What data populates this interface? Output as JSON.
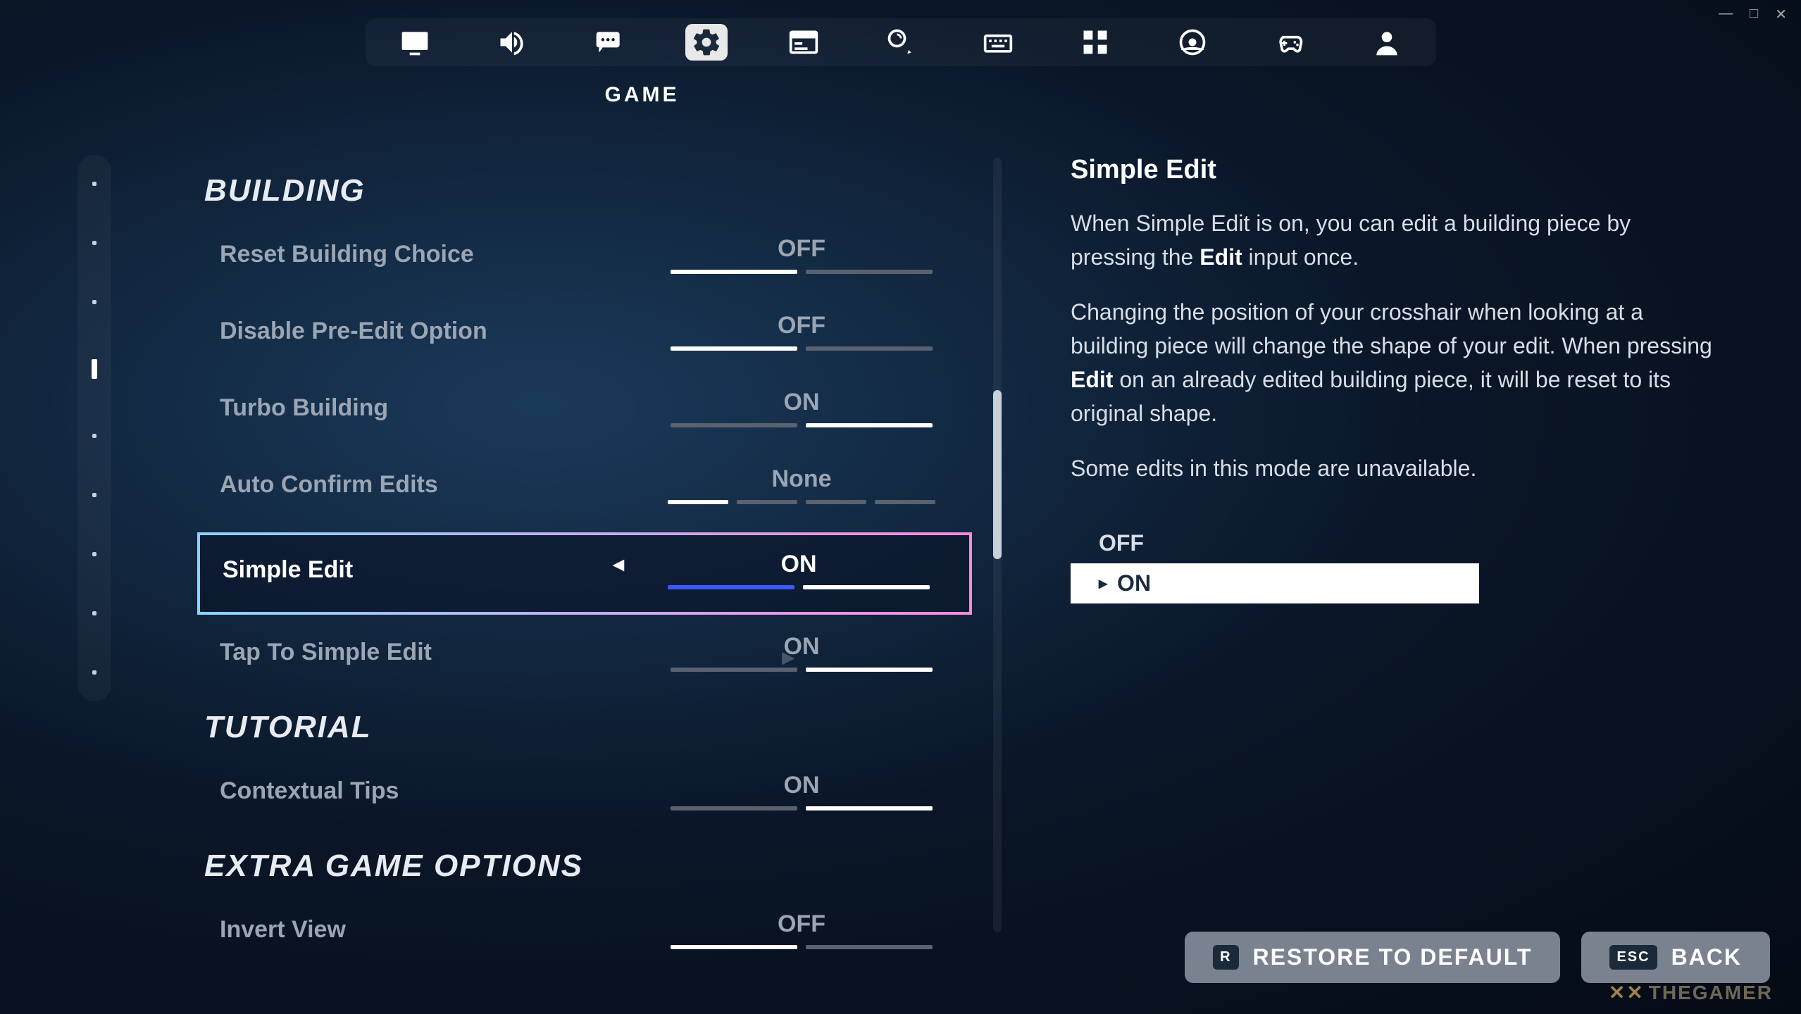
{
  "window_controls": {
    "min": "—",
    "max": "□",
    "close": "✕"
  },
  "top_nav": {
    "tabs": [
      {
        "name": "display-icon"
      },
      {
        "name": "audio-icon"
      },
      {
        "name": "chat-icon"
      },
      {
        "name": "gear-icon",
        "active": true
      },
      {
        "name": "ui-icon"
      },
      {
        "name": "touch-gear-icon"
      },
      {
        "name": "keyboard-icon"
      },
      {
        "name": "grid-icon"
      },
      {
        "name": "wrench-gear-icon"
      },
      {
        "name": "controller-icon"
      },
      {
        "name": "person-icon"
      }
    ],
    "active_label": "GAME"
  },
  "sections": {
    "building": {
      "title": "BUILDING",
      "rows": [
        {
          "label": "Reset Building Choice",
          "value": "OFF",
          "segs": [
            "on",
            "off"
          ]
        },
        {
          "label": "Disable Pre-Edit Option",
          "value": "OFF",
          "segs": [
            "on",
            "off"
          ]
        },
        {
          "label": "Turbo Building",
          "value": "ON",
          "segs": [
            "off",
            "on"
          ]
        },
        {
          "label": "Auto Confirm Edits",
          "value": "None",
          "segs": [
            "on",
            "off",
            "off",
            "off"
          ],
          "quad": true
        },
        {
          "label": "Simple Edit",
          "value": "ON",
          "segs": [
            "on",
            "on"
          ],
          "selected": true,
          "arrows": true,
          "blue_first": true
        },
        {
          "label": "Tap To Simple Edit",
          "value": "ON",
          "segs": [
            "off",
            "on"
          ],
          "play": true
        }
      ]
    },
    "tutorial": {
      "title": "TUTORIAL",
      "rows": [
        {
          "label": "Contextual Tips",
          "value": "ON",
          "segs": [
            "off",
            "on"
          ]
        }
      ]
    },
    "extra": {
      "title": "EXTRA GAME OPTIONS",
      "rows": [
        {
          "label": "Invert View",
          "value": "OFF",
          "segs": [
            "on",
            "off"
          ]
        }
      ]
    }
  },
  "description": {
    "title": "Simple Edit",
    "p1a": "When Simple Edit is on, you can edit a building piece by pressing the ",
    "p1b": "Edit",
    "p1c": " input once.",
    "p2a": "Changing the position of your crosshair when looking at a building piece will change the shape of your edit. When pressing ",
    "p2b": "Edit",
    "p2c": " on an already edited building piece, it will be reset to its original shape.",
    "p3": "Some edits in this mode are unavailable.",
    "options": [
      {
        "label": "OFF",
        "selected": false
      },
      {
        "label": "ON",
        "selected": true
      }
    ]
  },
  "buttons": {
    "restore": {
      "key": "R",
      "label": "RESTORE TO DEFAULT"
    },
    "back": {
      "key": "ESC",
      "label": "BACK"
    }
  },
  "watermark": "THEGAMER"
}
